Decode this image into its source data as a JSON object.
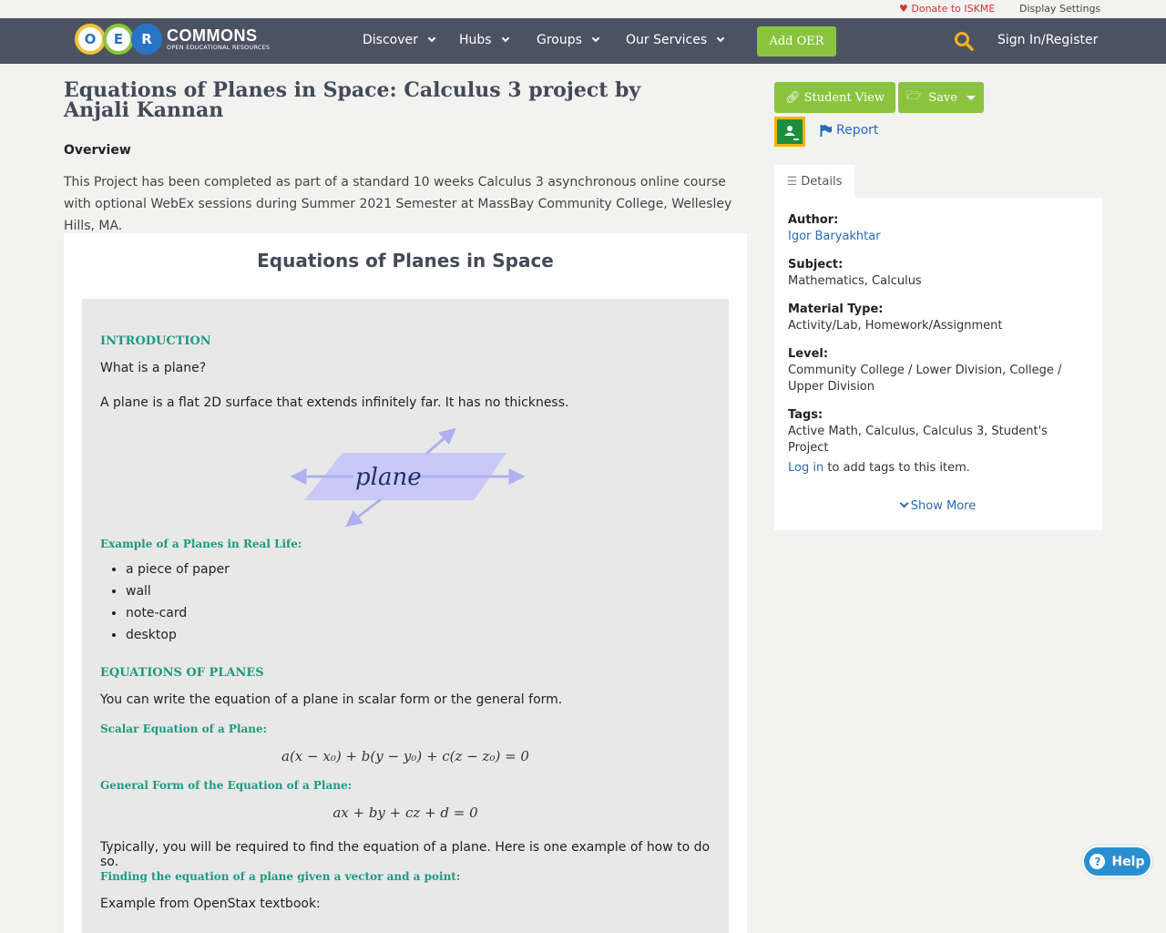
{
  "util": {
    "donate": "Donate to ISKME",
    "display": "Display Settings"
  },
  "brand": {
    "letters": [
      "O",
      "E",
      "R"
    ],
    "name": "COMMONS",
    "tagline": "OPEN EDUCATIONAL RESOURCES"
  },
  "nav": {
    "items": [
      "Discover",
      "Hubs",
      "Groups",
      "Our Services"
    ],
    "add_oer": "Add OER",
    "signin": "Sign In/Register"
  },
  "page": {
    "title": "Equations of Planes in Space: Calculus 3 project by Anjali Kannan",
    "overview_heading": "Overview",
    "overview_text": "This Project has been completed as part of a standard 10 weeks Calculus 3 asynchronous online course with optional WebEx sessions during Summer 2021 Semester at MassBay Community College, Wellesley Hills, MA."
  },
  "content": {
    "title": "Equations of Planes in Space",
    "intro_heading": "INTRODUCTION",
    "q": "What is a plane?",
    "def": "A plane is a flat 2D surface that extends infinitely far. It has no thickness.",
    "plane_label": "plane",
    "example_heading": "Example of a Planes in Real Life:",
    "examples": [
      "a piece of paper",
      "wall",
      "note-card",
      "desktop"
    ],
    "eq_heading": "EQUATIONS OF PLANES",
    "eq_intro": "You can write the equation of a plane in scalar form or the general form.",
    "scalar_heading": "Scalar Equation of a Plane:",
    "scalar_eq": "a(x − x₀) + b(y − y₀) + c(z − z₀) = 0",
    "general_heading": "General Form of the Equation of a Plane:",
    "general_eq": "ax + by + cz + d = 0",
    "typically": "Typically, you will be required to find the equation of a plane. Here is one example of how to do so.",
    "finding_heading": "Finding the equation of a plane given a vector and a point:",
    "example_from": "Example from OpenStax textbook:"
  },
  "sidebar": {
    "student_view": "Student View",
    "save": "Save",
    "report": "Report",
    "details_tab": "Details",
    "author_label": "Author:",
    "author": "Igor Baryakhtar",
    "subject_label": "Subject:",
    "subject": "Mathematics, Calculus",
    "material_label": "Material Type:",
    "material": "Activity/Lab, Homework/Assignment",
    "level_label": "Level:",
    "level": "Community College / Lower Division, College / Upper Division",
    "tags_label": "Tags:",
    "tags": "Active Math, Calculus, Calculus 3, Student's Project",
    "login_link": "Log in",
    "login_rest": " to add tags to this item.",
    "show_more": "Show More"
  },
  "help": "Help",
  "colors": {
    "nav_bg": "#4b5363",
    "accent_green": "#8ac43f",
    "teal": "#1c9a80",
    "link": "#2a6ab8",
    "donate_red": "#d4333b"
  }
}
